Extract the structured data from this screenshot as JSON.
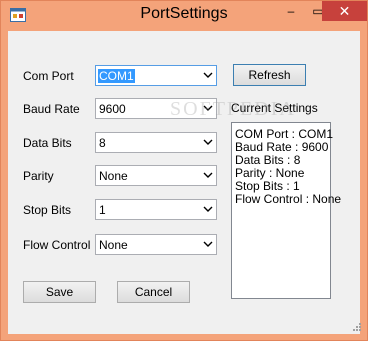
{
  "window": {
    "title": "PortSettings",
    "controls": {
      "minimize": "–",
      "maximize": "▭",
      "close": "✕"
    }
  },
  "form": {
    "fields": [
      {
        "label": "Com Port",
        "value": "COM1",
        "selected": true
      },
      {
        "label": "Baud Rate",
        "value": "9600"
      },
      {
        "label": "Data Bits",
        "value": "8"
      },
      {
        "label": "Parity",
        "value": "None"
      },
      {
        "label": "Stop Bits",
        "value": "1"
      },
      {
        "label": "Flow Control",
        "value": "None"
      }
    ],
    "refresh_label": "Refresh",
    "current_settings_label": "Current Settings",
    "current_settings": [
      "COM Port : COM1",
      "Baud Rate : 9600",
      "Data Bits : 8",
      "Parity : None",
      "Stop Bits : 1",
      "Flow Control : None"
    ],
    "save_label": "Save",
    "cancel_label": "Cancel"
  },
  "watermark": "SOFTPEDIA",
  "colors": {
    "title_bar": "#f4a37a",
    "close_button": "#c7413c",
    "selection": "#3399ff",
    "client_background": "#f0f0f0"
  },
  "icons": {
    "app": "app-window-icon",
    "dropdown": "chevron-down-icon",
    "resize": "resize-grip-icon"
  }
}
